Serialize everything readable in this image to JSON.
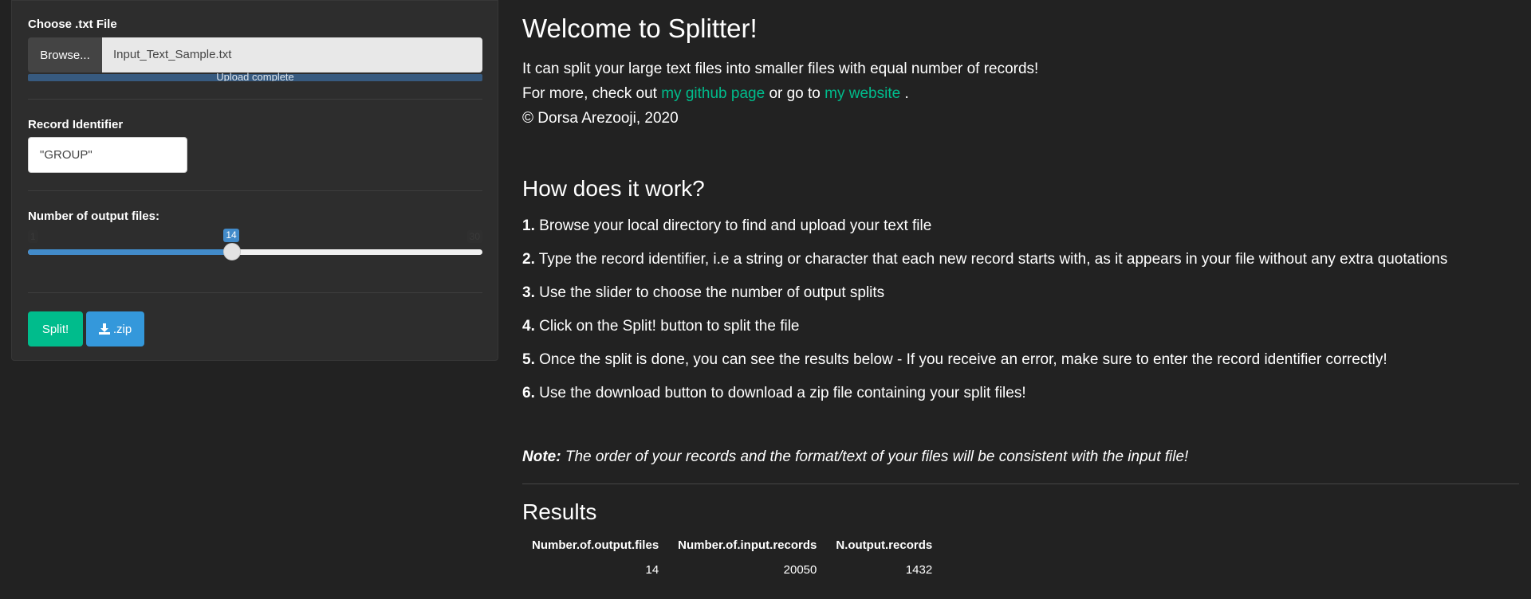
{
  "sidebar": {
    "file_label": "Choose .txt File",
    "browse_label": "Browse...",
    "file_name": "Input_Text_Sample.txt",
    "upload_status": "Upload complete",
    "upload_progress_percent": 100,
    "record_label": "Record Identifier",
    "record_value": "\"GROUP\"",
    "slider_label": "Number of output files:",
    "slider": {
      "min": 1,
      "max": 30,
      "value": 14
    },
    "split_label": "Split!",
    "zip_label": ".zip",
    "zip_icon": "download-icon"
  },
  "main": {
    "title": "Welcome to Splitter!",
    "intro_line1": "It can split your large text files into smaller files with equal number of records!",
    "intro_prefix": "For more, check out",
    "github_link": "my github page",
    "intro_middle": "or go to",
    "website_link": "my website",
    "intro_suffix": ".",
    "copyright": "© Dorsa Arezooji, 2020",
    "how_title": "How does it work?",
    "steps": [
      {
        "num": "1.",
        "text": "Browse your local directory to find and upload your text file"
      },
      {
        "num": "2.",
        "text": "Type the record identifier, i.e a string or character that each new record starts with, as it appears in your file without any extra quotations"
      },
      {
        "num": "3.",
        "text": "Use the slider to choose the number of output splits"
      },
      {
        "num": "4.",
        "text": "Click on the Split! button to split the file"
      },
      {
        "num": "5.",
        "text": "Once the split is done, you can see the results below - If you receive an error, make sure to enter the record identifier correctly!"
      },
      {
        "num": "6.",
        "text": "Use the download button to download a zip file containing your split files!"
      }
    ],
    "note_label": "Note:",
    "note_text": "The order of your records and the format/text of your files will be consistent with the input file!",
    "results_title": "Results",
    "results_table": {
      "headers": [
        "Number.of.output.files",
        "Number.of.input.records",
        "N.output.records"
      ],
      "rows": [
        [
          "14",
          "20050",
          "1432"
        ]
      ]
    }
  }
}
